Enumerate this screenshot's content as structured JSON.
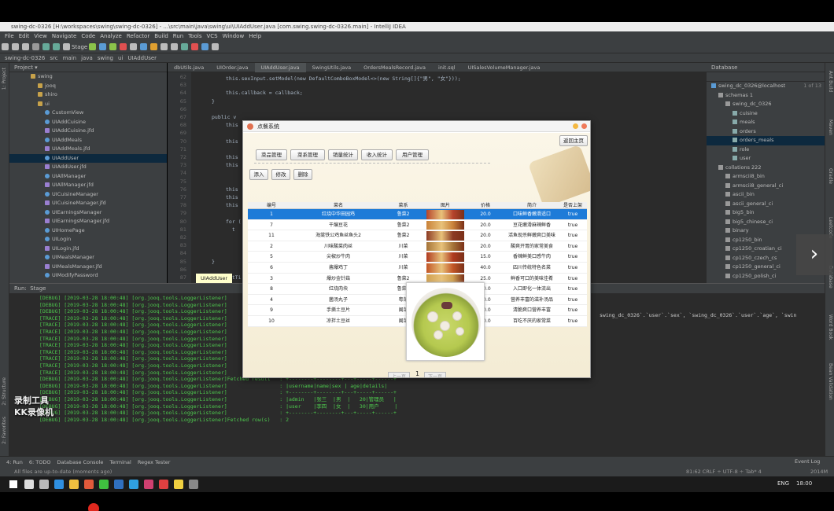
{
  "ide": {
    "window_title": "swing-dc-0326 [H:\\workspaces\\swing\\swing-dc-0326] - ...\\src\\main\\java\\swing\\ui\\UIAddUser.java [com.swing.swing-dc-0326.main] - IntelliJ IDEA",
    "menu": [
      "File",
      "Edit",
      "View",
      "Navigate",
      "Code",
      "Analyze",
      "Refactor",
      "Build",
      "Run",
      "Tools",
      "VCS",
      "Window",
      "Help"
    ],
    "nav": [
      "swing-dc-0326",
      "src",
      "main",
      "java",
      "swing",
      "ui",
      "UIAddUser"
    ],
    "run_config": "Stage",
    "project_label": "Project",
    "tree": [
      {
        "label": "swing",
        "type": "folder",
        "indent": 3
      },
      {
        "label": "jooq",
        "type": "folder",
        "indent": 4
      },
      {
        "label": "shiro",
        "type": "folder",
        "indent": 4
      },
      {
        "label": "ui",
        "type": "folder",
        "indent": 4
      },
      {
        "label": "CustomView",
        "type": "class",
        "indent": 5
      },
      {
        "label": "UIAddCuisine",
        "type": "class",
        "indent": 5
      },
      {
        "label": "UIAddCuisine.jfd",
        "type": "form",
        "indent": 5
      },
      {
        "label": "UIAddMeals",
        "type": "class",
        "indent": 5
      },
      {
        "label": "UIAddMeals.jfd",
        "type": "form",
        "indent": 5
      },
      {
        "label": "UIAddUser",
        "type": "class",
        "indent": 5,
        "selected": true
      },
      {
        "label": "UIAddUser.jfd",
        "type": "form",
        "indent": 5
      },
      {
        "label": "UIAllManager",
        "type": "class",
        "indent": 5
      },
      {
        "label": "UIAllManager.jfd",
        "type": "form",
        "indent": 5
      },
      {
        "label": "UICuisineManager",
        "type": "class",
        "indent": 5
      },
      {
        "label": "UICuisineManager.jfd",
        "type": "form",
        "indent": 5
      },
      {
        "label": "UIEarningsManager",
        "type": "class",
        "indent": 5
      },
      {
        "label": "UIEarningsManager.jfd",
        "type": "form",
        "indent": 5
      },
      {
        "label": "UIHomePage",
        "type": "class",
        "indent": 5
      },
      {
        "label": "UILogin",
        "type": "class",
        "indent": 5
      },
      {
        "label": "UILogin.jfd",
        "type": "form",
        "indent": 5
      },
      {
        "label": "UIMealsManager",
        "type": "class",
        "indent": 5
      },
      {
        "label": "UIMealsManager.jfd",
        "type": "form",
        "indent": 5
      },
      {
        "label": "UIModifyPassword",
        "type": "class",
        "indent": 5
      }
    ],
    "editor_tabs": [
      {
        "label": "dbUtils.java"
      },
      {
        "label": "UIOrder.java"
      },
      {
        "label": "UIAddUser.java",
        "active": true
      },
      {
        "label": "SwingUtils.java"
      },
      {
        "label": "OrdersMealsRecord.java"
      },
      {
        "label": "init.sql"
      },
      {
        "label": "UISalesVolumeManager.java"
      }
    ],
    "code_lines": [
      {
        "n": "62",
        "text": "this.sexInput.setModel(new DefaultComboBoxModel<>(new String[]{\"男\", \"女\"}));"
      },
      {
        "n": "63",
        "text": ""
      },
      {
        "n": "64",
        "text": "this.callback = callback;"
      },
      {
        "n": "65",
        "text": "}"
      },
      {
        "n": "66",
        "text": ""
      },
      {
        "n": "67",
        "text": "public v"
      },
      {
        "n": "68",
        "text": "this"
      },
      {
        "n": "69",
        "text": ""
      },
      {
        "n": "70",
        "text": "this"
      },
      {
        "n": "71",
        "text": ""
      },
      {
        "n": "72",
        "text": "this"
      },
      {
        "n": "73",
        "text": "this"
      },
      {
        "n": "74",
        "text": ""
      },
      {
        "n": "75",
        "text": ""
      },
      {
        "n": "76",
        "text": "this"
      },
      {
        "n": "77",
        "text": "this"
      },
      {
        "n": "78",
        "text": "this"
      },
      {
        "n": "79",
        "text": ""
      },
      {
        "n": "80",
        "text": "for ("
      },
      {
        "n": "81",
        "text": "  t"
      },
      {
        "n": "82",
        "text": ""
      },
      {
        "n": "83",
        "text": ""
      },
      {
        "n": "84",
        "text": ""
      },
      {
        "n": "85",
        "text": "}"
      },
      {
        "n": "86",
        "text": ""
      },
      {
        "n": "87",
        "text": "setTi"
      }
    ],
    "editor_breadcrumb": "UIAddUser",
    "db_panel_label": "Database",
    "db_tree": [
      {
        "label": "swing_dc_0326@localhost",
        "note": "1 of 13",
        "indent": 0
      },
      {
        "label": "schemas 1",
        "indent": 1
      },
      {
        "label": "swing_dc_0326",
        "indent": 2
      },
      {
        "label": "cuisine",
        "indent": 3
      },
      {
        "label": "meals",
        "indent": 3
      },
      {
        "label": "orders",
        "indent": 3
      },
      {
        "label": "orders_meals",
        "indent": 3,
        "selected": true
      },
      {
        "label": "role",
        "indent": 3
      },
      {
        "label": "user",
        "indent": 3
      },
      {
        "label": "collations 222",
        "indent": 1
      },
      {
        "label": "armscii8_bin",
        "indent": 2
      },
      {
        "label": "armscii8_general_ci",
        "indent": 2
      },
      {
        "label": "ascii_bin",
        "indent": 2
      },
      {
        "label": "ascii_general_ci",
        "indent": 2
      },
      {
        "label": "big5_bin",
        "indent": 2
      },
      {
        "label": "big5_chinese_ci",
        "indent": 2
      },
      {
        "label": "binary",
        "indent": 2
      },
      {
        "label": "cp1250_bin",
        "indent": 2
      },
      {
        "label": "cp1250_croatian_ci",
        "indent": 2
      },
      {
        "label": "cp1250_czech_cs",
        "indent": 2
      },
      {
        "label": "cp1250_general_ci",
        "indent": 2
      },
      {
        "label": "cp1250_polish_ci",
        "indent": 2
      }
    ],
    "run_label": "Run:",
    "run_tab": "Stage",
    "log_lines": [
      "[DEBUG] [2019-03-28 18:00:48] [org.jooq.tools.LoggerListener]",
      "[DEBUG] [2019-03-28 18:00:48] [org.jooq.tools.LoggerListener]",
      "[DEBUG] [2019-03-28 18:00:48] [org.jooq.tools.LoggerListener]",
      "[TRACE] [2019-03-28 18:00:48] [org.jooq.tools.LoggerListener]",
      "[TRACE] [2019-03-28 18:00:48] [org.jooq.tools.LoggerListener]",
      "[TRACE] [2019-03-28 18:00:48] [org.jooq.tools.LoggerListener]",
      "[TRACE] [2019-03-28 18:00:48] [org.jooq.tools.LoggerListener]",
      "[TRACE] [2019-03-28 18:00:48] [org.jooq.tools.LoggerListener]",
      "[TRACE] [2019-03-28 18:00:48] [org.jooq.tools.LoggerListener]",
      "[TRACE] [2019-03-28 18:00:48] [org.jooq.tools.LoggerListener]",
      "[TRACE] [2019-03-28 18:00:48] [org.jooq.tools.LoggerListener]",
      "[TRACE] [2019-03-28 18:00:48] [org.jooq.tools.LoggerListener]          : |user   |李四  |女  |   30|用户     |",
      "[DEBUG] [2019-03-28 18:00:48] [org.jooq.tools.LoggerListener]Fetched result   : +--------+--------+---+-----+------+",
      "[DEBUG] [2019-03-28 18:00:48] [org.jooq.tools.LoggerListener]                 : |username|name|sex | age|details|",
      "[DEBUG] [2019-03-28 18:00:48] [org.jooq.tools.LoggerListener]                 : +--------+--------+---+-----+------+",
      "[DEBUG] [2019-03-28 18:00:48] [org.jooq.tools.LoggerListener]                 : |admin   |张三  |男  |   20|管理员   |",
      "[DEBUG] [2019-03-28 18:00:48] [org.jooq.tools.LoggerListener]                 : |user    |李四  |女  |   30|用户     |",
      "[DEBUG] [2019-03-28 18:00:48] [org.jooq.tools.LoggerListener]                 : +--------+--------+---+-----+------+",
      "[DEBUG] [2019-03-28 18:00:48] [org.jooq.tools.LoggerListener]Fetched row(s)   : 2"
    ],
    "sql_snippet": "swing_dc_0326`.`user`.`sex`, `swing_dc_0326`.`user`.`age`, `swin",
    "bottom_tabs": [
      "4: Run",
      "6: TODO",
      "Database Console",
      "Terminal",
      "Regex Tester"
    ],
    "event_log": "Event Log",
    "status_left": "All files are up-to-date (moments ago)",
    "status_right": "81:62   CRLF ÷   UTF-8 ÷   Tab* 4",
    "memory": "2014M",
    "watermark": [
      "录制工具",
      "KK录像机"
    ],
    "left_strip": [
      "1: Project",
      "2: Structure",
      "2: Favorites"
    ],
    "right_strip": [
      "Ant Build",
      "Maven",
      "Gradle",
      "Leetcode",
      "Database",
      "Word Book",
      "Bean Validation"
    ]
  },
  "taskbar": {
    "lang": "ENG",
    "time": "18:00",
    "icons": [
      {
        "name": "windows-start-icon",
        "color": "#ffffff"
      },
      {
        "name": "search-icon",
        "color": "#dddddd"
      },
      {
        "name": "task-view-icon",
        "color": "#bbbbbb"
      },
      {
        "name": "edge-icon",
        "color": "#2f8fe0"
      },
      {
        "name": "file-explorer-icon",
        "color": "#f0c040"
      },
      {
        "name": "chrome-icon",
        "color": "#e25a3b"
      },
      {
        "name": "wechat-icon",
        "color": "#40c040"
      },
      {
        "name": "store-icon",
        "color": "#3070c0"
      },
      {
        "name": "qq-icon",
        "color": "#30a0e0"
      },
      {
        "name": "intellij-icon",
        "color": "#d04070"
      },
      {
        "name": "music-icon",
        "color": "#e04040"
      },
      {
        "name": "notes-icon",
        "color": "#f0d040"
      },
      {
        "name": "settings-icon",
        "color": "#888888"
      }
    ]
  },
  "app": {
    "title": "点餐系统",
    "back_button": "返回主页",
    "nav_buttons": [
      "菜品管理",
      "菜系管理",
      "销量统计",
      "收入统计",
      "用户管理"
    ],
    "action_buttons": [
      "添入",
      "修改",
      "删除"
    ],
    "columns": [
      "编号",
      "菜名",
      "菜系",
      "图片",
      "价格",
      "简介",
      "是否上架"
    ],
    "rows": [
      {
        "id": "1",
        "name": "红烧中华田园鸡",
        "cuisine": "鲁菜2",
        "price": "20.0",
        "desc": "口味鲜香嫩滑适口",
        "on": "true",
        "selected": true,
        "img": "#b6432c"
      },
      {
        "id": "7",
        "name": "干煸豆花",
        "cuisine": "鲁菜2",
        "price": "20.0",
        "desc": "豆花嫩滑麻辣鲜香",
        "on": "true",
        "img": "#c9823a"
      },
      {
        "id": "11",
        "name": "海棠铁公鸡鱼丝鱼头2",
        "cuisine": "鲁菜2",
        "price": "20.0",
        "desc": "活鱼现杀鲜嫩爽口美味",
        "on": "true",
        "img": "#8c3a24"
      },
      {
        "id": "2",
        "name": "川味酸菜肉丝",
        "cuisine": "川菜",
        "price": "20.0",
        "desc": "酸爽开胃的家常美食",
        "on": "true",
        "img": "#a57338"
      },
      {
        "id": "5",
        "name": "尖椒炒牛肉",
        "cuisine": "川菜",
        "price": "15.0",
        "desc": "香辣鲜美口感牛肉",
        "on": "true",
        "img": "#b03a20"
      },
      {
        "id": "6",
        "name": "酱爆鸡丁",
        "cuisine": "川菜",
        "price": "40.0",
        "desc": "四川传统特色名菜",
        "on": "true",
        "img": "#c25526"
      },
      {
        "id": "3",
        "name": "爆炒金针菇",
        "cuisine": "鲁菜2",
        "price": "25.0",
        "desc": "鲜香可口的美味佳肴",
        "on": "true",
        "img": "#d0a050"
      },
      {
        "id": "8",
        "name": "红烧肉块",
        "cuisine": "鲁菜2",
        "price": "20.0",
        "desc": "入口即化一体流出",
        "on": "true",
        "img": "#8a2a18"
      },
      {
        "id": "4",
        "name": "菌汤丸子",
        "cuisine": "粤菜",
        "price": "20.0",
        "desc": "营养丰富的滋补汤品",
        "on": "true",
        "img": "#b8c060"
      },
      {
        "id": "9",
        "name": "手撕土豆片",
        "cuisine": "闽菜",
        "price": "20.0",
        "desc": "清脆爽口营养丰富",
        "on": "true",
        "img": "#d9b870"
      },
      {
        "id": "10",
        "name": "凉拌土豆丝",
        "cuisine": "闽菜",
        "price": "20.0",
        "desc": "百吃不厌的家常菜",
        "on": "true",
        "img": "#c79850"
      }
    ],
    "pager": {
      "prev": "上一页",
      "page": "1",
      "next": "下一页"
    }
  }
}
